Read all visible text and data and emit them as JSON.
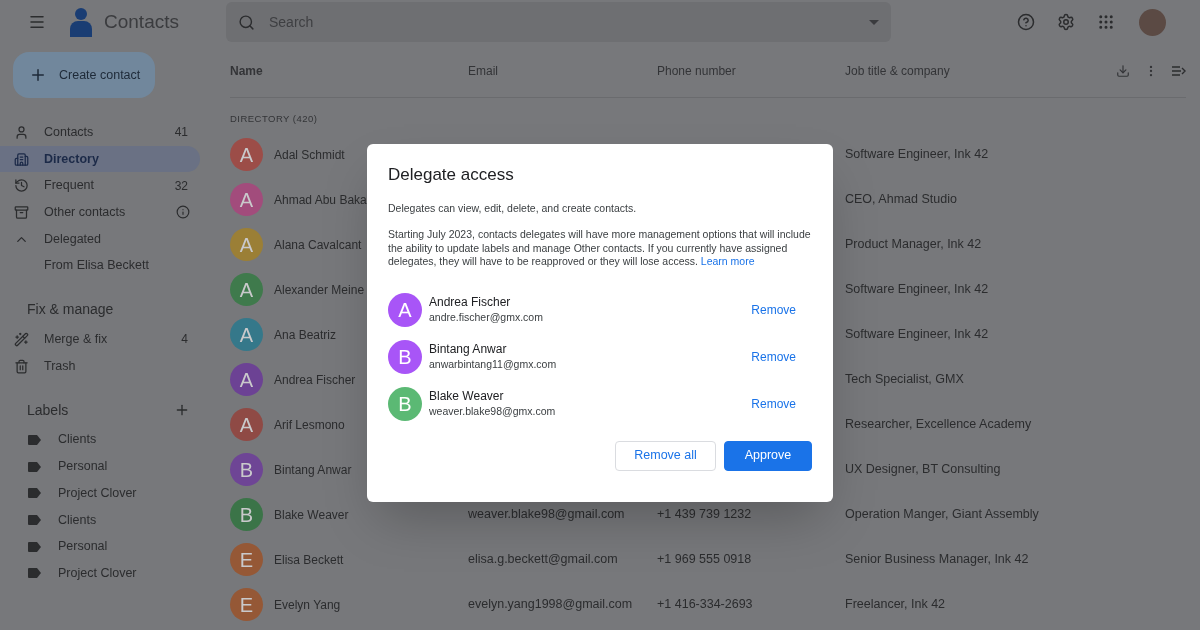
{
  "header": {
    "app_name": "Contacts",
    "search": {
      "placeholder": "Search"
    }
  },
  "sidebar": {
    "create_button": "Create contact",
    "nav": [
      {
        "label": "Contacts",
        "count": "41",
        "selected": false
      },
      {
        "label": "Directory",
        "selected": true
      },
      {
        "label": "Frequent",
        "count": "32",
        "selected": false
      },
      {
        "label": "Other contacts",
        "selected": false
      },
      {
        "label": "Delegated",
        "selected": false,
        "expanded": true,
        "children": [
          {
            "label": "From Elisa Beckett",
            "selected": false
          }
        ]
      }
    ],
    "fix_manage": {
      "title": "Fix & manage",
      "items": [
        {
          "label": "Merge & fix",
          "count": "4",
          "selected": false
        },
        {
          "label": "Trash",
          "selected": false
        }
      ]
    },
    "labels": {
      "title": "Labels",
      "items": [
        {
          "label": "Clients"
        },
        {
          "label": "Personal"
        },
        {
          "label": "Project Clover"
        },
        {
          "label": "Clients"
        },
        {
          "label": "Personal"
        },
        {
          "label": "Project Clover"
        }
      ]
    }
  },
  "table": {
    "columns": [
      "Name",
      "Email",
      "Phone number",
      "Job title & company"
    ],
    "section": "DIRECTORY (420)",
    "rows": [
      {
        "letter": "A",
        "color": "#9c4d48",
        "name": "Adal Schmidt",
        "job": "Software Engineer, Ink 42"
      },
      {
        "letter": "A",
        "color": "#a24c7c",
        "name": "Ahmad Abu Baka",
        "job": "CEO, Ahmad Studio"
      },
      {
        "letter": "A",
        "color": "#9b7f36",
        "name": "Alana Cavalcant",
        "job": "Product Manager, Ink 42"
      },
      {
        "letter": "A",
        "color": "#3f7a4c",
        "name": "Alexander Meine",
        "job": "Software Engineer, Ink 42"
      },
      {
        "letter": "A",
        "color": "#35788a",
        "name": "Ana Beatriz",
        "job": "Software Engineer, Ink 42"
      },
      {
        "letter": "A",
        "color": "#6c4294",
        "name": "Andrea Fischer",
        "job": "Tech Specialist, GMX"
      },
      {
        "letter": "A",
        "color": "#8f4a45",
        "name": "Arif Lesmono",
        "job": "Researcher, Excellence Academy"
      },
      {
        "letter": "B",
        "color": "#6e4595",
        "name": "Bintang Anwar",
        "job": "UX Designer, BT Consulting"
      },
      {
        "letter": "B",
        "color": "#3b7448",
        "name": "Blake Weaver",
        "email": "weaver.blake98@gmail.com",
        "phone": "+1 439 739 1232",
        "job": "Operation Manger, Giant Assembly"
      },
      {
        "letter": "E",
        "color": "#955836",
        "name": "Elisa Beckett",
        "email": "elisa.g.beckett@gmail.com",
        "phone": "+1 969 555 0918",
        "job": "Senior Business Manager, Ink 42"
      },
      {
        "letter": "E",
        "color": "#955836",
        "name": "Evelyn Yang",
        "email": "evelyn.yang1998@gmail.com",
        "phone": "+1 416-334-2693",
        "job": "Freelancer, Ink 42"
      }
    ]
  },
  "dialog": {
    "title": "Delegate access",
    "paragraphs": [
      {
        "text": "Delegates can view, edit, delete, and create contacts."
      },
      {
        "text": "Starting July 2023, contacts delegates will have more management options that will include the ability to update labels and manage Other contacts. If you currently have assigned delegates, they will have to be reapproved or they will lose access.",
        "link": "Learn more"
      }
    ],
    "delegates": [
      {
        "letter": "A",
        "color": "#a855f7",
        "name": "Andrea Fischer",
        "email": "andre.fischer@gmx.com",
        "action": "Remove"
      },
      {
        "letter": "B",
        "color": "#a855f7",
        "name": "Bintang Anwar",
        "email": "anwarbintang11@gmx.com",
        "action": "Remove"
      },
      {
        "letter": "B",
        "color": "#5bb974",
        "name": "Blake Weaver",
        "email": "weaver.blake98@gmx.com",
        "action": "Remove"
      }
    ],
    "buttons": [
      {
        "label": "Remove all",
        "kind": "secondary"
      },
      {
        "label": "Approve",
        "kind": "primary"
      }
    ]
  }
}
